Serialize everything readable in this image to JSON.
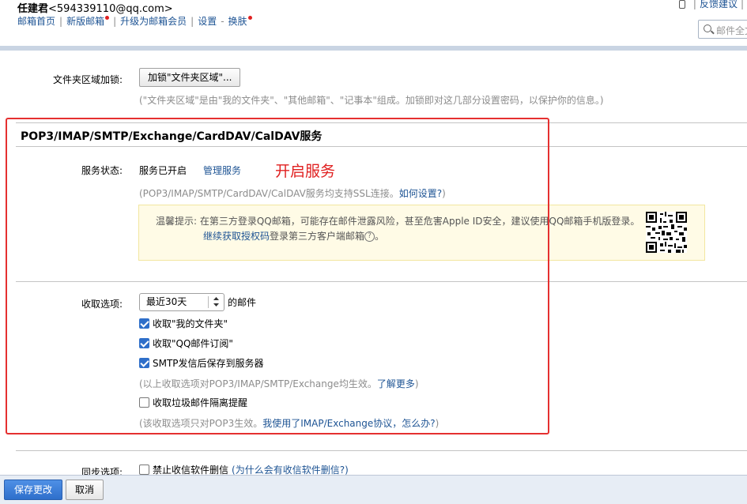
{
  "header": {
    "user_name": "任建君",
    "user_email": "<594339110@qq.com>",
    "nav": {
      "home": "邮箱首页",
      "new_version": "新版邮箱",
      "upgrade": "升级为邮箱会员",
      "settings": "设置",
      "dash": "-",
      "skin": "换肤"
    },
    "top_right": {
      "feedback": "反馈建议"
    },
    "search_placeholder": "邮件全文"
  },
  "folder_lock": {
    "label": "文件夹区域加锁:",
    "button": "加锁\"文件夹区域\"...",
    "hint": "(\"文件夹区域\"是由\"我的文件夹\"、\"其他邮箱\"、\"记事本\"组成。加锁即对这几部分设置密码，以保护你的信息。)"
  },
  "service": {
    "title": "POP3/IMAP/SMTP/Exchange/CardDAV/CalDAV服务",
    "status_label": "服务状态:",
    "status_value": "服务已开启",
    "manage_link": "管理服务",
    "annotation": "开启服务",
    "ssl_hint": "(POP3/IMAP/SMTP/CardDAV/CalDAV服务均支持SSL连接。",
    "ssl_link": "如何设置?",
    "ssl_close": ")",
    "warning": {
      "line1": "温馨提示: 在第三方登录QQ邮箱，可能存在邮件泄露风险，甚至危害Apple ID安全，建议使用QQ邮箱手机版登录。",
      "link": "继续获取授权码",
      "line2_rest": "登录第三方客户端邮箱",
      "help": "?",
      "period": "。"
    }
  },
  "receive": {
    "label": "收取选项:",
    "range_selected": "最近30天",
    "range_suffix": "的邮件",
    "options": [
      {
        "label": "收取\"我的文件夹\"",
        "checked": true
      },
      {
        "label": "收取\"QQ邮件订阅\"",
        "checked": true
      },
      {
        "label": "SMTP发信后保存到服务器",
        "checked": true
      }
    ],
    "hint1": "(以上收取选项对POP3/IMAP/SMTP/Exchange均生效。",
    "hint1_link": "了解更多",
    "hint1_close": ")",
    "spam_option": {
      "label": "收取垃圾邮件隔离提醒",
      "checked": false
    },
    "hint2": "(该收取选项只对POP3生效。",
    "hint2_link": "我使用了IMAP/Exchange协议，怎么办?",
    "hint2_close": ")"
  },
  "sync": {
    "label": "同步选项:",
    "option": "禁止收信软件删信",
    "hint_link": "(为什么会有收信软件删信?)"
  },
  "footer": {
    "save": "保存更改",
    "cancel": "取消"
  },
  "colors": {
    "link": "#1e5494",
    "annotation_red": "#e02020",
    "primary_button": "#2e6fcb",
    "checkbox": "#2f6fc9",
    "warning_bg": "#fffbe6"
  }
}
